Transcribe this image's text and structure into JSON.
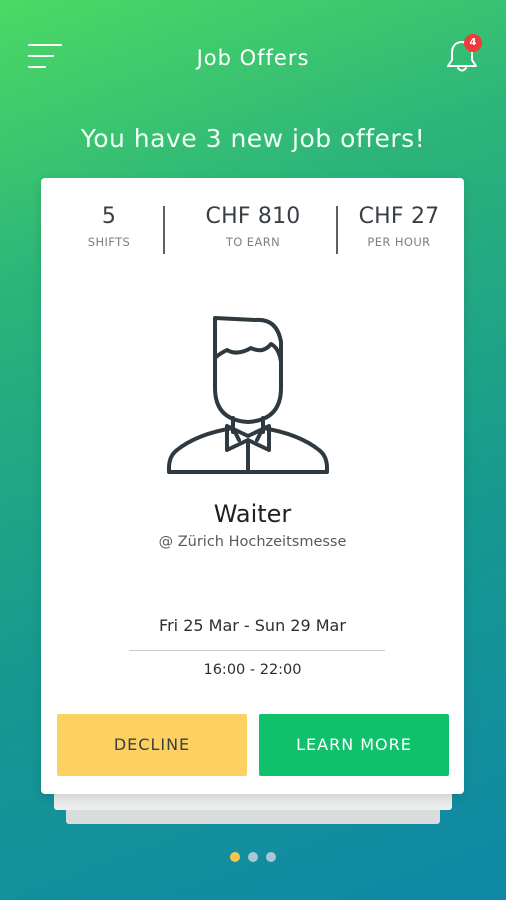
{
  "header": {
    "title": "Job Offers",
    "menu_icon": "hamburger-menu-icon",
    "bell_icon": "bell-icon",
    "notification_count": "4"
  },
  "headline": "You have 3 new job offers!",
  "offer": {
    "stats": [
      {
        "value": "5",
        "label": "SHIFTS"
      },
      {
        "value": "CHF 810",
        "label": "TO EARN"
      },
      {
        "value": "CHF 27",
        "label": "PER HOUR"
      }
    ],
    "avatar_icon": "waiter-avatar-icon",
    "job_title": "Waiter",
    "venue": "@ Zürich Hochzeitsmesse",
    "dates": "Fri 25 Mar - Sun 29 Mar",
    "time": "16:00 - 22:00",
    "decline_label": "DECLINE",
    "learn_more_label": "LEARN MORE"
  },
  "pagination": {
    "total": 3,
    "active_index": 0
  },
  "colors": {
    "decline_button": "#fdd062",
    "learn_more_button": "#10c16b",
    "badge": "#ee3b3b",
    "active_dot": "#f5c84c",
    "inactive_dot": "#a9c8d6"
  }
}
